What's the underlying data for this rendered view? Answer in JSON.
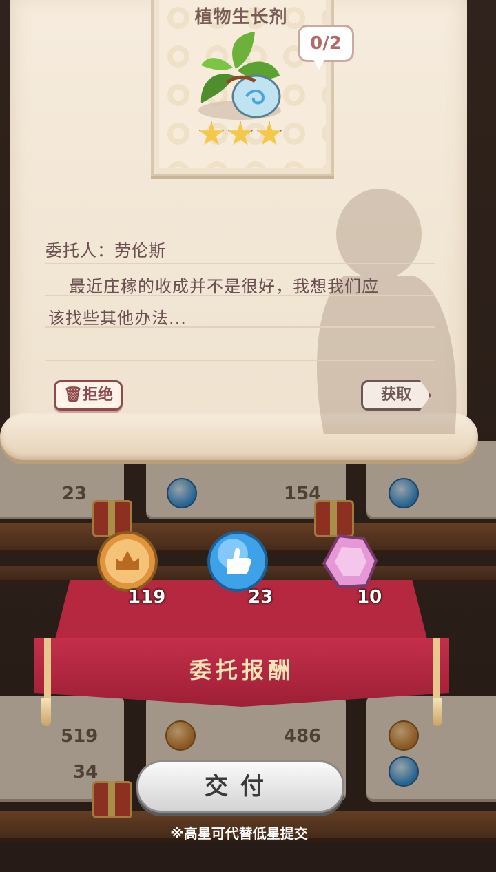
{
  "background": {
    "cards": [
      {
        "value": "23"
      },
      {
        "value": "154"
      },
      {
        "value": "519"
      },
      {
        "value": "486"
      },
      {
        "value": "34"
      }
    ]
  },
  "item": {
    "name": "植物生长剂",
    "progress": "0/2",
    "stars": 3
  },
  "quest": {
    "client": "委托人：劳伦斯",
    "line1": "最近庄稼的收成并不是很好，我想我们应",
    "line2": "该找些其他办法..."
  },
  "buttons": {
    "refuse": "拒绝",
    "get": "获取",
    "submit": "交付"
  },
  "rewards": {
    "title": "委托报酬",
    "items": [
      {
        "icon": "gold-coin-icon",
        "amount": "119"
      },
      {
        "icon": "thumbs-up-orb-icon",
        "amount": "23"
      },
      {
        "icon": "pink-gem-icon",
        "amount": "10"
      }
    ]
  },
  "note": "※高星可代替低星提交",
  "colors": {
    "banner": "#b5283f",
    "parchment": "#f6ecdd",
    "text": "#6b4f4f"
  }
}
